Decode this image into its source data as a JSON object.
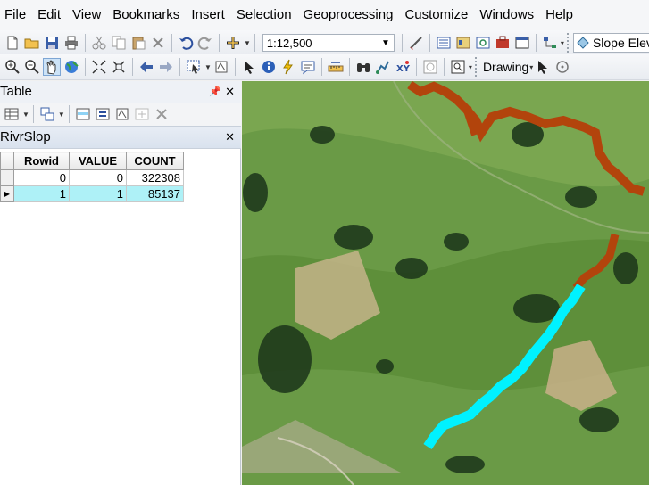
{
  "menu": [
    "File",
    "Edit",
    "View",
    "Bookmarks",
    "Insert",
    "Selection",
    "Geoprocessing",
    "Customize",
    "Windows",
    "Help"
  ],
  "toolbar": {
    "scale_value": "1:12,500",
    "layer_dropdown": "Slope Elevat",
    "drawing_label": "Drawing"
  },
  "table_window": {
    "title": "Table",
    "tab_name": "RivrSlop",
    "columns": [
      "Rowid",
      "VALUE",
      "COUNT"
    ],
    "rows": [
      {
        "Rowid": "0",
        "VALUE": "0",
        "COUNT": "322308"
      },
      {
        "Rowid": "1",
        "VALUE": "1",
        "COUNT": "85137"
      }
    ],
    "selected_row_index": 1
  },
  "colors": {
    "river_slope_orange": "#b2440c",
    "river_slope_cyan": "#00f2ff",
    "selection_highlight": "#aef1f7"
  }
}
